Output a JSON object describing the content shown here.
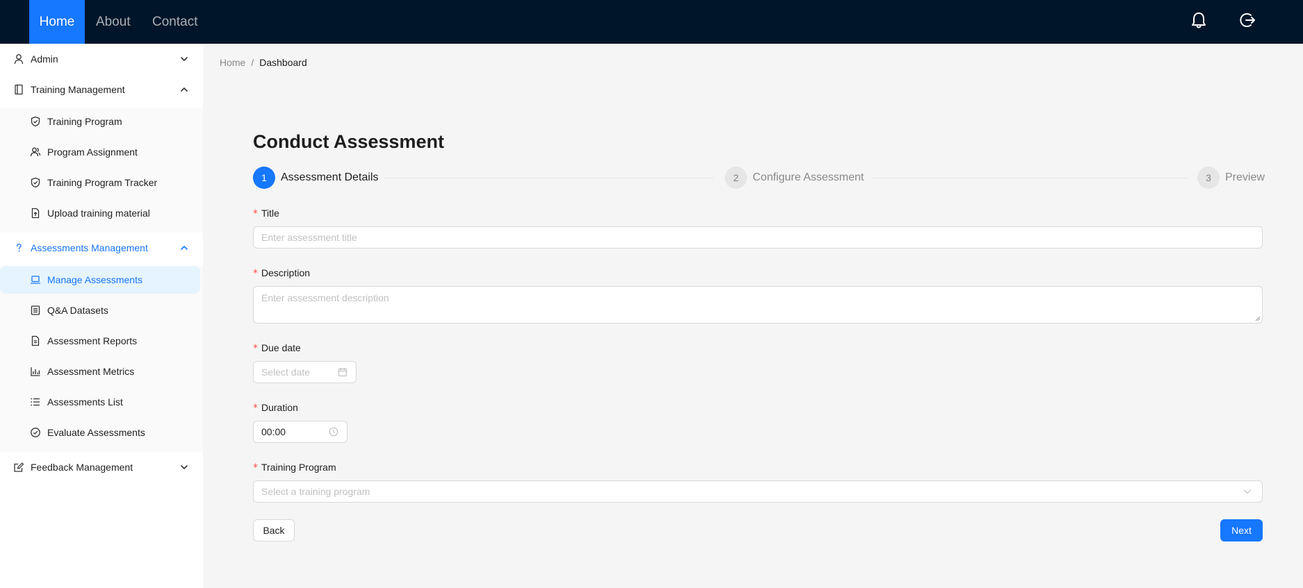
{
  "header": {
    "nav": [
      {
        "label": "Home",
        "active": true
      },
      {
        "label": "About",
        "active": false
      },
      {
        "label": "Contact",
        "active": false
      }
    ],
    "icons": [
      "bell-icon",
      "logout-icon"
    ]
  },
  "sidebar": {
    "admin": {
      "label": "Admin",
      "icon": "user-icon"
    },
    "training": {
      "label": "Training Management",
      "icon": "book-icon",
      "items": [
        {
          "label": "Training Program",
          "icon": "shield-check-icon"
        },
        {
          "label": "Program Assignment",
          "icon": "users-icon"
        },
        {
          "label": "Training Program Tracker",
          "icon": "shield-check-icon"
        },
        {
          "label": "Upload training material",
          "icon": "file-upload-icon"
        }
      ]
    },
    "assessments": {
      "label": "Assessments Management",
      "icon": "question-icon",
      "items": [
        {
          "label": "Manage Assessments",
          "icon": "laptop-icon",
          "selected": true
        },
        {
          "label": "Q&A Datasets",
          "icon": "list-box-icon"
        },
        {
          "label": "Assessment Reports",
          "icon": "file-text-icon"
        },
        {
          "label": "Assessment Metrics",
          "icon": "bar-chart-icon"
        },
        {
          "label": "Assessments List",
          "icon": "list-icon"
        },
        {
          "label": "Evaluate Assessments",
          "icon": "check-circle-icon"
        }
      ]
    },
    "feedback": {
      "label": "Feedback Management",
      "icon": "edit-icon"
    }
  },
  "breadcrumb": {
    "home": "Home",
    "separator": "/",
    "current": "Dashboard"
  },
  "page": {
    "title": "Conduct Assessment"
  },
  "steps": [
    {
      "number": "1",
      "title": "Assessment Details",
      "status": "process"
    },
    {
      "number": "2",
      "title": "Configure Assessment",
      "status": "wait"
    },
    {
      "number": "3",
      "title": "Preview",
      "status": "wait"
    }
  ],
  "form": {
    "required_mark": "*",
    "title": {
      "label": "Title",
      "placeholder": "Enter assessment title",
      "value": ""
    },
    "description": {
      "label": "Description",
      "placeholder": "Enter assessment description",
      "value": ""
    },
    "due_date": {
      "label": "Due date",
      "placeholder": "Select date"
    },
    "duration": {
      "label": "Duration",
      "value": "00:00"
    },
    "training_program": {
      "label": "Training Program",
      "placeholder": "Select a training program"
    }
  },
  "buttons": {
    "back": "Back",
    "next": "Next"
  },
  "colors": {
    "primary": "#1677ff",
    "header_bg": "#001529",
    "required": "#ff4d4f",
    "selected_bg": "#e6f4ff"
  }
}
